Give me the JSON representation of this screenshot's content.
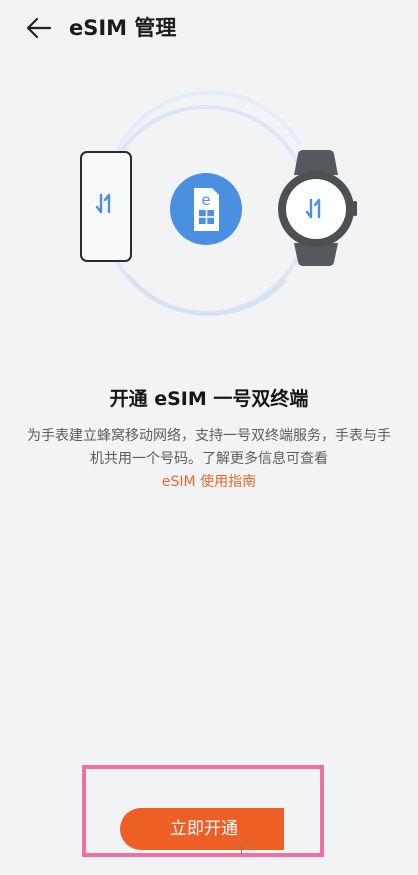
{
  "header": {
    "title": "eSIM 管理",
    "back_icon": "arrow-left-icon"
  },
  "illustration": {
    "phone_icon": "phone-icon",
    "sim_icon": "esim-card-icon",
    "sim_letter": "e",
    "watch_icon": "smartwatch-icon",
    "transfer_icon": "transfer-arrows-icon",
    "accent_color": "#4a8fe0"
  },
  "content": {
    "title": "开通 eSIM 一号双终端",
    "description": "为手表建立蜂窝移动网络，支持一号双终端服务，手表与手机共用一个号码。了解更多信息可查看",
    "link_text": "eSIM 使用指南"
  },
  "action": {
    "button_label": "立即开通",
    "button_color": "#ee5f26",
    "highlight_color": "#f06fa3"
  }
}
